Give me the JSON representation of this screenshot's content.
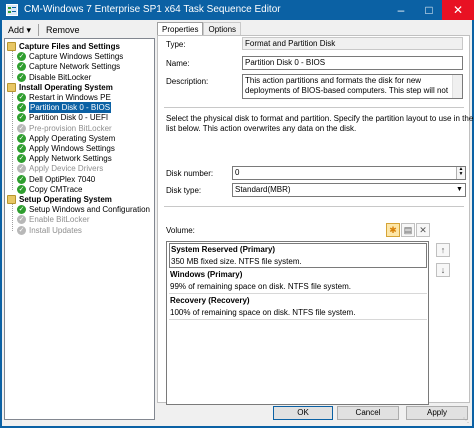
{
  "window": {
    "title": "CM-Windows 7 Enterprise SP1 x64 Task Sequence Editor"
  },
  "toolbar": {
    "add_label": "Add ▾",
    "remove_label": "Remove"
  },
  "tree": [
    {
      "label": "Capture Files and Settings",
      "type": "group",
      "level": 0
    },
    {
      "label": "Capture Windows Settings",
      "type": "step",
      "level": 1
    },
    {
      "label": "Capture Network Settings",
      "type": "step",
      "level": 1
    },
    {
      "label": "Disable BitLocker",
      "type": "step",
      "level": 1
    },
    {
      "label": "Install Operating System",
      "type": "group",
      "level": 0
    },
    {
      "label": "Restart in Windows PE",
      "type": "step",
      "level": 1
    },
    {
      "label": "Partition Disk 0 - BIOS",
      "type": "step",
      "level": 1,
      "selected": true
    },
    {
      "label": "Partition Disk 0 - UEFI",
      "type": "step",
      "level": 1
    },
    {
      "label": "Pre-provision BitLocker",
      "type": "step",
      "level": 1,
      "disabled": true
    },
    {
      "label": "Apply Operating System",
      "type": "step",
      "level": 1
    },
    {
      "label": "Apply Windows Settings",
      "type": "step",
      "level": 1
    },
    {
      "label": "Apply Network Settings",
      "type": "step",
      "level": 1
    },
    {
      "label": "Apply Device Drivers",
      "type": "step",
      "level": 1,
      "disabled": true
    },
    {
      "label": "Dell OptiPlex 7040",
      "type": "step",
      "level": 1
    },
    {
      "label": "Copy CMTrace",
      "type": "step",
      "level": 1
    },
    {
      "label": "Setup Operating System",
      "type": "group",
      "level": 0
    },
    {
      "label": "Setup Windows and Configuration",
      "type": "step",
      "level": 1
    },
    {
      "label": "Enable BitLocker",
      "type": "step",
      "level": 1,
      "disabled": true
    },
    {
      "label": "Install Updates",
      "type": "step",
      "level": 1,
      "disabled": true
    }
  ],
  "tabs": {
    "properties": "Properties",
    "options": "Options"
  },
  "props": {
    "type_label": "Type:",
    "type_value": "Format and Partition Disk",
    "name_label": "Name:",
    "name_value": "Partition Disk 0 - BIOS",
    "desc_label": "Description:",
    "desc_value": "This action partitions and formats the disk for new deployments of BIOS-based computers. This step will not",
    "info_line1": "Select the physical disk to format and partition. Specify the partition layout to use in the",
    "info_line2": "list below. This action overwrites any data on the disk.",
    "disk_number_label": "Disk number:",
    "disk_number_value": "0",
    "disk_type_label": "Disk type:",
    "disk_type_value": "Standard(MBR)",
    "volume_label": "Volume:"
  },
  "volumes": [
    {
      "title": "System Reserved (Primary)",
      "detail": "350 MB fixed size. NTFS file system."
    },
    {
      "title": "Windows (Primary)",
      "detail": "99% of remaining space on disk. NTFS file system."
    },
    {
      "title": "Recovery (Recovery)",
      "detail": "100% of remaining space on disk. NTFS file system."
    }
  ],
  "buttons": {
    "ok": "OK",
    "cancel": "Cancel",
    "apply": "Apply"
  },
  "colors": {
    "titlebar": "#0b61a4",
    "check": "#2f9e2f",
    "close": "#e81123"
  },
  "icons": {
    "app": "task-sequence-icon",
    "minimize": "minimize-icon",
    "maximize": "maximize-icon",
    "close": "close-icon",
    "new_volume": "new-volume-icon",
    "properties": "volume-properties-icon",
    "delete": "delete-volume-icon",
    "move_up": "move-up-icon",
    "move_down": "move-down-icon"
  }
}
